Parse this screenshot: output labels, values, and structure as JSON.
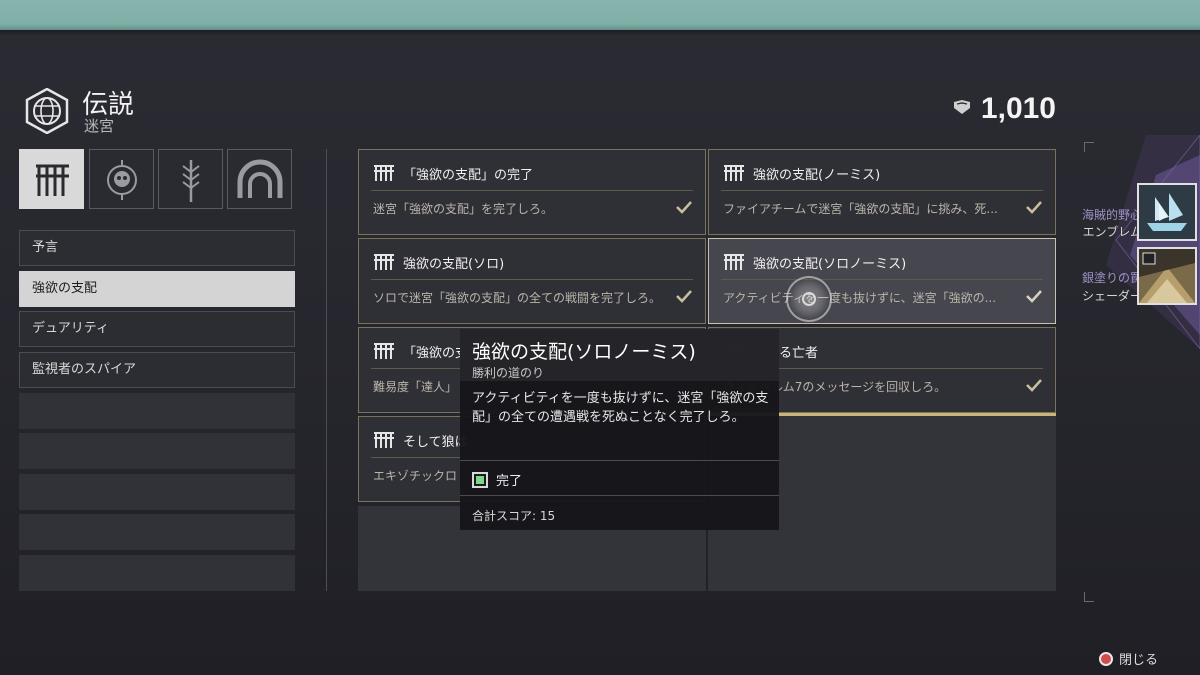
{
  "header": {
    "title": "伝説",
    "subtitle": "迷宮"
  },
  "currency": {
    "icon": "bright-dust-icon",
    "amount": "1,010"
  },
  "tabs": [
    {
      "icon": "dungeon-gate-icon",
      "active": true
    },
    {
      "icon": "skull-seal-icon",
      "active": false
    },
    {
      "icon": "sword-feather-icon",
      "active": false
    },
    {
      "icon": "arch-icon",
      "active": false
    }
  ],
  "sidebar": {
    "items": [
      {
        "label": "予言"
      },
      {
        "label": "強欲の支配"
      },
      {
        "label": "デュアリティ"
      },
      {
        "label": "監視者のスパイア"
      }
    ]
  },
  "cards": [
    {
      "title": "「強欲の支配」の完了",
      "desc": "迷宮「強欲の支配」を完了しろ。"
    },
    {
      "title": "強欲の支配(ノーミス)",
      "desc": "ファイアチームで迷宮「強欲の支配」に挑み、死..."
    },
    {
      "title": "強欲の支配(ソロ)",
      "desc": "ソロで迷宮「強欲の支配」の全ての戦闘を完了しろ。"
    },
    {
      "title": "強欲の支配(ソロノーミス)",
      "desc": "アクティビティを一度も抜けずに、迷宮「強欲の..."
    },
    {
      "title": "「強欲の支",
      "desc": "難易度「達人」"
    },
    {
      "title": "富める亡者",
      "desc": "ウィルベルム7のメッセージを回収しろ。"
    },
    {
      "title": "そして狼は",
      "desc": "エキゾチックロ"
    }
  ],
  "tooltip": {
    "title": "強欲の支配(ソロノーミス)",
    "subtitle": "勝利の道のり",
    "description": "アクティビティを一度も抜けずに、迷宮「強欲の支配」の全ての遭遇戦を死ぬことなく完了しろ。",
    "objective_label": "完了",
    "objective_complete": true,
    "score_label": "合計スコア: 15"
  },
  "seals": [
    {
      "name": "海賊的野心",
      "type": "エンブレム",
      "icon": "ghost-ship-emblem-icon"
    },
    {
      "name": "銀塗りの罠",
      "type": "シェーダー",
      "icon": "shader-icon"
    }
  ],
  "footer": {
    "close_label": "閉じる",
    "close_icon": "circle-button-icon"
  },
  "colors": {
    "accent_gold": "#c9b47a",
    "seal_purple": "#9f93c9",
    "complete_green": "#7ed68a",
    "topbar": "#86b5ad"
  }
}
